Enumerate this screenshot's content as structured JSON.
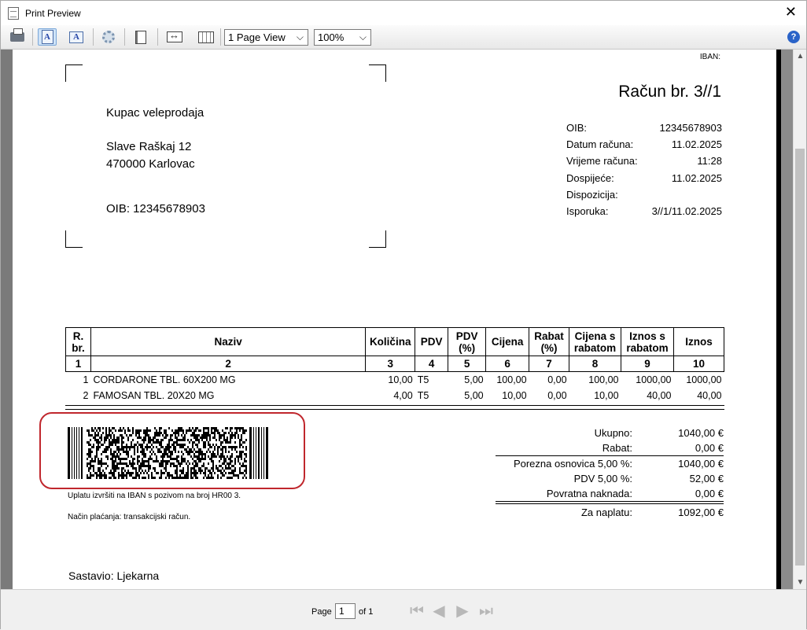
{
  "window": {
    "title": "Print Preview",
    "close_glyph": "✕"
  },
  "toolbar": {
    "page_view": "1 Page View",
    "zoom": "100%",
    "doc_icon_letter": "A",
    "help_glyph": "?"
  },
  "invoice": {
    "iban_label": "IBAN:",
    "title": "Račun br. 3//1",
    "customer": {
      "name": "Kupac veleprodaja",
      "street": "Slave Raškaj 12",
      "city": "470000 Karlovac",
      "oib": "OIB: 12345678903"
    },
    "meta": [
      {
        "label": "OIB:",
        "value": "12345678903"
      },
      {
        "label": "Datum računa:",
        "value": "11.02.2025"
      },
      {
        "label": "Vrijeme računa:",
        "value": "11:28"
      },
      {
        "label": "Dospijeće:",
        "value": "11.02.2025"
      },
      {
        "label": "Dispozicija:",
        "value": ""
      },
      {
        "label": "Isporuka:",
        "value": "3//1/11.02.2025"
      }
    ],
    "table": {
      "headers": [
        "R. br.",
        "Naziv",
        "Količina",
        "PDV",
        "PDV (%)",
        "Cijena",
        "Rabat (%)",
        "Cijena s rabatom",
        "Iznos s rabatom",
        "Iznos"
      ],
      "col_numbers": [
        "1",
        "2",
        "3",
        "4",
        "5",
        "6",
        "7",
        "8",
        "9",
        "10"
      ],
      "rows": [
        [
          "1",
          "CORDARONE TBL. 60X200 MG",
          "10,00",
          "T5",
          "5,00",
          "100,00",
          "0,00",
          "100,00",
          "1000,00",
          "1000,00"
        ],
        [
          "2",
          "FAMOSAN TBL. 20X20 MG",
          "4,00",
          "T5",
          "5,00",
          "10,00",
          "0,00",
          "10,00",
          "40,00",
          "40,00"
        ]
      ]
    },
    "payment_note": "Uplatu izvršiti na IBAN s pozivom na broj HR00 3.",
    "payment_method": "Način plaćanja: transakcijski račun.",
    "totals": [
      {
        "label": "Ukupno:",
        "value": "1040,00 €"
      },
      {
        "label": "Rabat:",
        "value": "0,00 €"
      },
      {
        "label": "Porezna osnovica 5,00 %:",
        "value": "1040,00 €"
      },
      {
        "label": "PDV 5,00 %:",
        "value": "52,00 €"
      },
      {
        "label": "Povratna naknada:",
        "value": "0,00 €"
      },
      {
        "label": "Za naplatu:",
        "value": "1092,00 €"
      }
    ],
    "author": "Sastavio: Ljekarna"
  },
  "status": {
    "page_label": "Page",
    "page_value": "1",
    "of_label": "of 1"
  }
}
